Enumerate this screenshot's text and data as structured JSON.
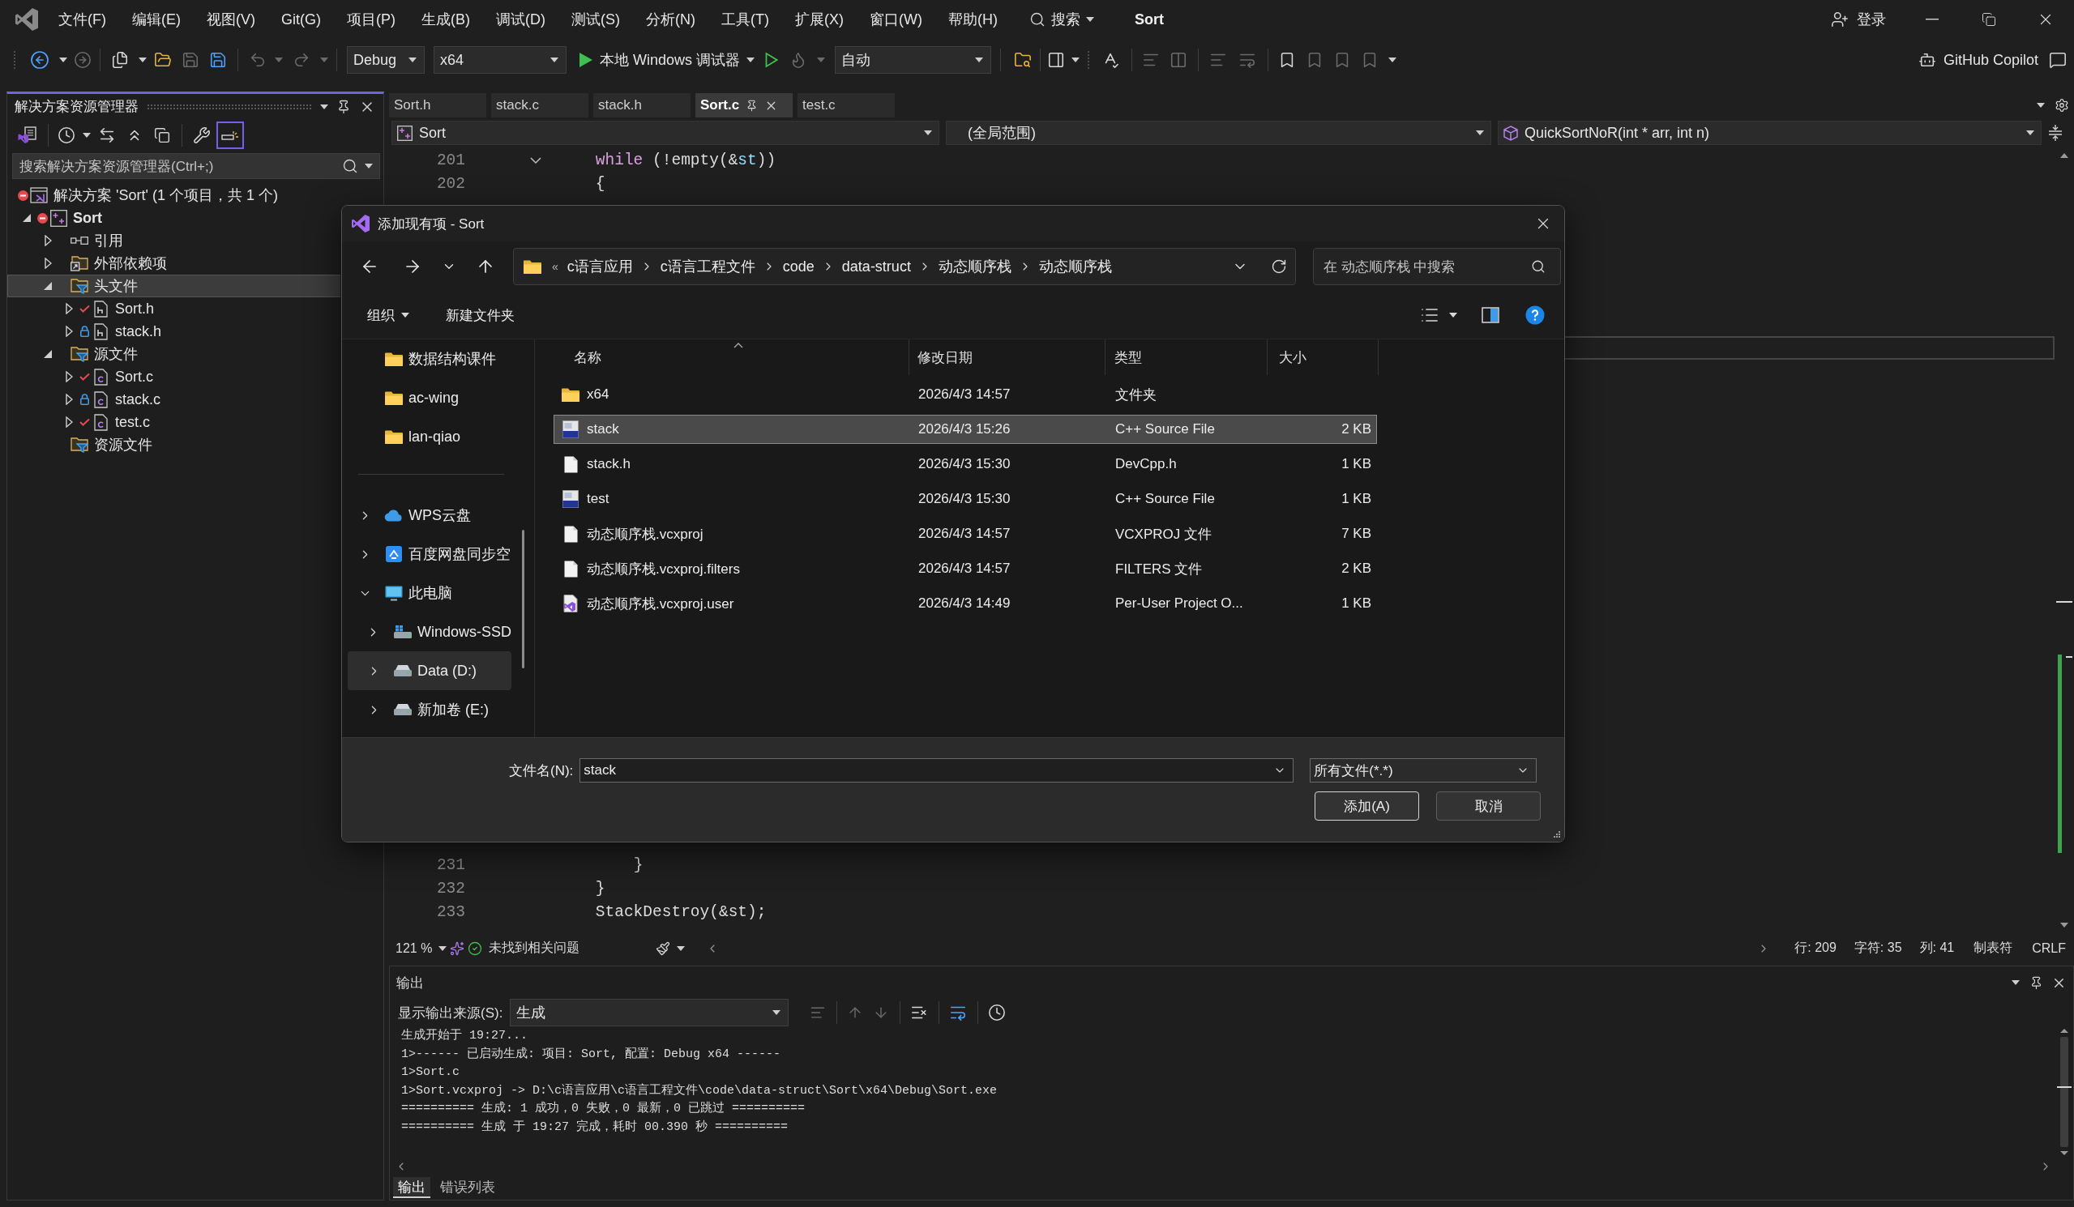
{
  "window": {
    "title": "Sort",
    "search": "搜索",
    "account": "登录"
  },
  "menu": [
    "文件(F)",
    "编辑(E)",
    "视图(V)",
    "Git(G)",
    "项目(P)",
    "生成(B)",
    "调试(D)",
    "测试(S)",
    "分析(N)",
    "工具(T)",
    "扩展(X)",
    "窗口(W)",
    "帮助(H)"
  ],
  "toolbar": {
    "configuration": "Debug",
    "platform": "x64",
    "start": "本地 Windows 调试器",
    "mode": "自动",
    "copilot": "GitHub Copilot"
  },
  "solution_explorer": {
    "title": "解决方案资源管理器",
    "search": {
      "placeholder": "搜索解决方案资源管理器(Ctrl+;)"
    },
    "tree": [
      {
        "label": "解决方案 'Sort' (1 个项目，共 1 个)",
        "kind": "solution",
        "excluded": true,
        "edited": false,
        "locked": false,
        "selected": false,
        "children": [
          {
            "label": "Sort",
            "kind": "project",
            "excluded": true,
            "edited": false,
            "locked": false,
            "expanded": true,
            "selected": false,
            "children": [
              {
                "label": "引用",
                "kind": "references",
                "excluded": false,
                "edited": false,
                "locked": false,
                "expanded": false,
                "selected": false
              },
              {
                "label": "外部依赖项",
                "kind": "external",
                "excluded": false,
                "edited": false,
                "locked": false,
                "expanded": false,
                "selected": false
              },
              {
                "label": "头文件",
                "kind": "filter",
                "excluded": false,
                "edited": false,
                "locked": false,
                "expanded": true,
                "selected": true,
                "children": [
                  {
                    "label": "Sort.h",
                    "kind": "header",
                    "excluded": false,
                    "edited": true,
                    "locked": false,
                    "expanded": false,
                    "selected": false
                  },
                  {
                    "label": "stack.h",
                    "kind": "header",
                    "excluded": false,
                    "edited": false,
                    "locked": true,
                    "expanded": false,
                    "selected": false
                  }
                ]
              },
              {
                "label": "源文件",
                "kind": "filter",
                "excluded": false,
                "edited": false,
                "locked": false,
                "expanded": true,
                "selected": false,
                "children": [
                  {
                    "label": "Sort.c",
                    "kind": "source",
                    "excluded": false,
                    "edited": true,
                    "locked": false,
                    "expanded": false,
                    "selected": false
                  },
                  {
                    "label": "stack.c",
                    "kind": "source",
                    "excluded": false,
                    "edited": false,
                    "locked": true,
                    "expanded": false,
                    "selected": false
                  },
                  {
                    "label": "test.c",
                    "kind": "source",
                    "excluded": false,
                    "edited": true,
                    "locked": false,
                    "expanded": false,
                    "selected": false
                  }
                ]
              },
              {
                "label": "资源文件",
                "kind": "filter",
                "excluded": false,
                "edited": false,
                "locked": false,
                "selected": false
              }
            ]
          }
        ]
      }
    ]
  },
  "editor": {
    "tabs": [
      {
        "label": "Sort.h",
        "selected": false
      },
      {
        "label": "stack.c",
        "selected": false
      },
      {
        "label": "stack.h",
        "selected": false
      },
      {
        "label": "Sort.c",
        "selected": true
      },
      {
        "label": "test.c",
        "selected": false
      }
    ],
    "navigation": {
      "project": "Sort",
      "scope": "(全局范围)",
      "member": "QuickSortNoR(int * arr, int n)"
    },
    "lines_top": [
      {
        "number": "201",
        "fold_start": true,
        "tokens": [
          {
            "text": "    while",
            "kind": "keyword"
          },
          {
            "text": " (!empty(&",
            "kind": "plain"
          },
          {
            "text": "st",
            "kind": "variable"
          },
          {
            "text": "))",
            "kind": "plain"
          }
        ]
      },
      {
        "number": "202",
        "fold_start": false,
        "tokens": [
          {
            "text": "    {",
            "kind": "plain"
          }
        ]
      }
    ],
    "lines_bottom": [
      {
        "number": "231",
        "fold_start": false,
        "tokens": [
          {
            "text": "        }",
            "kind": "plain"
          }
        ]
      },
      {
        "number": "232",
        "fold_start": false,
        "tokens": [
          {
            "text": "    }",
            "kind": "plain"
          }
        ]
      },
      {
        "number": "233",
        "fold_start": false,
        "tokens": [
          {
            "text": "    StackDestroy(&st);",
            "kind": "plain"
          }
        ]
      }
    ],
    "status": {
      "zoom": "121 %",
      "issues": "未找到相关问题",
      "line": "行: 209",
      "char": "字符: 35",
      "column": "列: 41",
      "indent": "制表符",
      "eol": "CRLF"
    }
  },
  "output": {
    "title": "输出",
    "source_label": "显示输出来源(S):",
    "source": "生成",
    "lines": [
      "生成开始于 19:27...",
      "1>------ 已启动生成: 项目: Sort, 配置: Debug x64 ------",
      "1>Sort.c",
      "1>Sort.vcxproj -> D:\\c语言应用\\c语言工程文件\\code\\data-struct\\Sort\\x64\\Debug\\Sort.exe",
      "========== 生成: 1 成功，0 失败，0 最新，0 已跳过 ==========",
      "========== 生成 于 19:27 完成，耗时 00.390 秒 =========="
    ],
    "tabs": [
      {
        "label": "输出",
        "selected": true
      },
      {
        "label": "错误列表",
        "selected": false
      }
    ]
  },
  "dialog": {
    "title": "添加现有项 - Sort",
    "overflow": "«",
    "path": [
      "c语言应用",
      "c语言工程文件",
      "code",
      "data-struct",
      "动态顺序栈",
      "动态顺序栈"
    ],
    "search": {
      "placeholder": "在 动态顺序栈 中搜索"
    },
    "commands": [
      "组织",
      "新建文件夹"
    ],
    "navigation": {
      "pinned": [
        {
          "label": "数据结构课件",
          "selected": false
        },
        {
          "label": "ac-wing",
          "selected": false
        },
        {
          "label": "lan-qiao",
          "selected": false
        }
      ],
      "locations": [
        {
          "label": "WPS云盘",
          "kind": "cloud",
          "expanded": false,
          "selected": false
        },
        {
          "label": "百度网盘同步空",
          "kind": "sync",
          "expanded": false,
          "selected": false
        },
        {
          "label": "此电脑",
          "kind": "pc",
          "expanded": true,
          "selected": false,
          "children": [
            {
              "label": "Windows-SSD",
              "kind": "system-drive",
              "expanded": false,
              "selected": false
            },
            {
              "label": "Data (D:)",
              "kind": "drive",
              "expanded": false,
              "selected": true
            },
            {
              "label": "新加卷 (E:)",
              "kind": "drive",
              "expanded": false,
              "selected": false
            }
          ]
        }
      ]
    },
    "columns": [
      "名称",
      "修改日期",
      "类型",
      "大小"
    ],
    "files": [
      {
        "name": "x64",
        "kind": "folder",
        "modified": "2026/4/3 14:57",
        "type": "文件夹",
        "selected": false
      },
      {
        "name": "stack",
        "kind": "cpp",
        "modified": "2026/4/3 15:26",
        "type": "C++ Source File",
        "size": "2 KB",
        "selected": true
      },
      {
        "name": "stack.h",
        "kind": "file",
        "modified": "2026/4/3 15:30",
        "type": "DevCpp.h",
        "size": "1 KB",
        "selected": false
      },
      {
        "name": "test",
        "kind": "cpp",
        "modified": "2026/4/3 15:30",
        "type": "C++ Source File",
        "size": "1 KB",
        "selected": false
      },
      {
        "name": "动态顺序栈.vcxproj",
        "kind": "file",
        "modified": "2026/4/3 14:57",
        "type": "VCXPROJ 文件",
        "size": "7 KB",
        "selected": false
      },
      {
        "name": "动态顺序栈.vcxproj.filters",
        "kind": "file",
        "modified": "2026/4/3 14:57",
        "type": "FILTERS 文件",
        "size": "2 KB",
        "selected": false
      },
      {
        "name": "动态顺序栈.vcxproj.user",
        "kind": "vs-user",
        "modified": "2026/4/3 14:49",
        "type": "Per-User Project O...",
        "size": "1 KB",
        "selected": false
      }
    ],
    "file_name": {
      "label": "文件名(N):",
      "value": "stack"
    },
    "filter": "所有文件(*.*)",
    "buttons": [
      {
        "label": "添加(A)",
        "default": true
      },
      {
        "label": "取消",
        "default": false
      }
    ]
  }
}
